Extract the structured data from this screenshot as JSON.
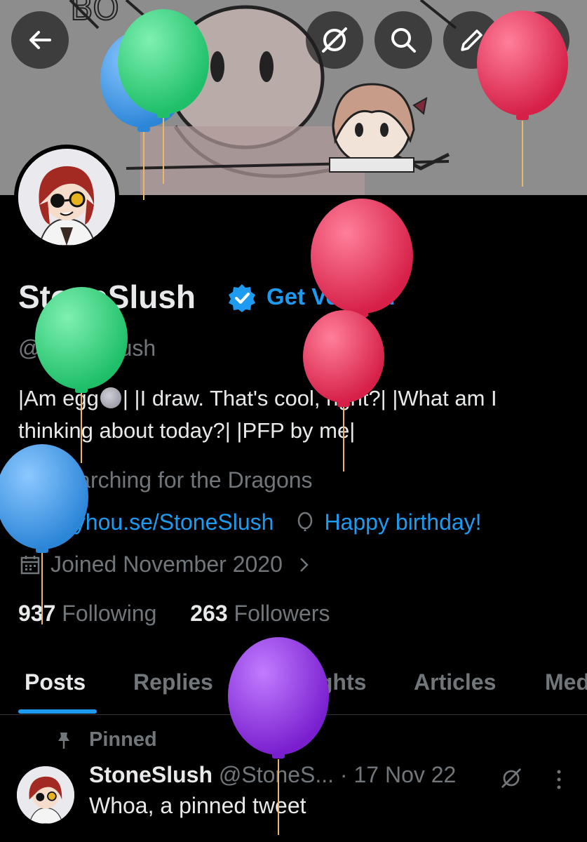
{
  "profile": {
    "name": "StoneSlush",
    "get_verified": "Get Verified",
    "handle": "@StoneSlush",
    "bio_line1": "|Am egg",
    "bio_line1b": "| |I draw. That's cool, right?| |What am I",
    "bio_line2": "thinking about today?| |PFP by me|",
    "location": "Searching for the Dragons",
    "website": "Toyhou.se/StoneSlush",
    "birthday": "Happy birthday!",
    "joined": "Joined November 2020",
    "following_count": "937",
    "following_label": "Following",
    "followers_count": "263",
    "followers_label": "Followers"
  },
  "banner": {
    "scribble_text": "BO"
  },
  "tabs": [
    {
      "label": "Posts"
    },
    {
      "label": "Replies"
    },
    {
      "label": "Highlights"
    },
    {
      "label": "Articles"
    },
    {
      "label": "Med"
    }
  ],
  "pinned_tweet": {
    "pinned_label": "Pinned",
    "author_name": "StoneSlush",
    "author_handle": "@StoneS...",
    "date": "· 17 Nov 22",
    "text": "Whoa, a pinned tweet"
  },
  "colors": {
    "accent": "#1d9bf0",
    "background": "#000000",
    "muted": "#71767b",
    "balloon_green": "#3ddc84",
    "balloon_blue": "#3b9be8",
    "balloon_red": "#e8305a",
    "balloon_purple": "#8b2bd6"
  },
  "icons": [
    "back-arrow-icon",
    "grok-icon",
    "search-icon",
    "compose-icon",
    "more-icon",
    "verified-badge-icon",
    "location-icon",
    "link-icon",
    "birthday-balloon-icon",
    "calendar-icon",
    "chevron-right-icon",
    "pin-icon"
  ]
}
